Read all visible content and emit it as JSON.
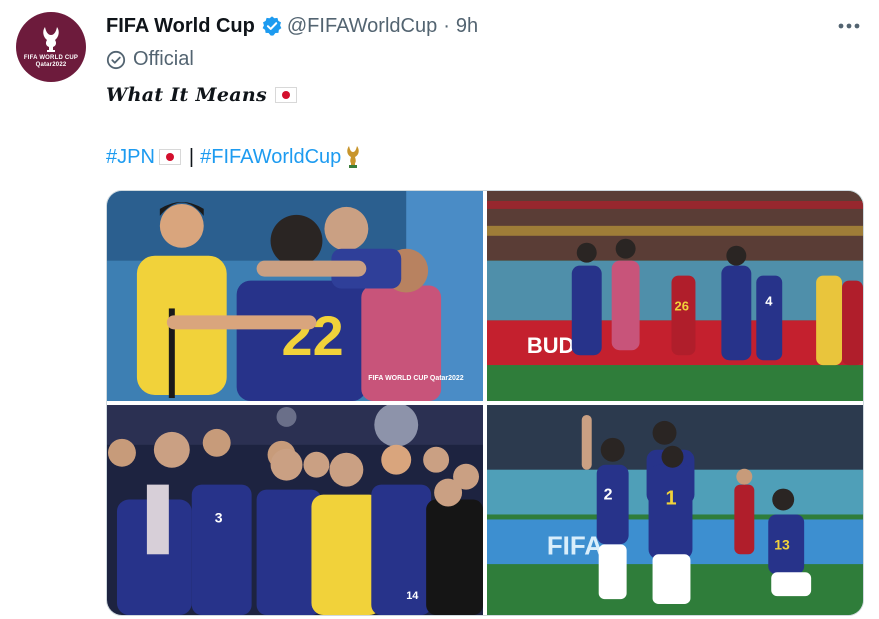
{
  "tweet": {
    "author_name": "FIFA World Cup",
    "handle": "@FIFAWorldCup",
    "separator": "·",
    "time": "9h",
    "label": "Official",
    "title": "What It Means",
    "hashtag_1": "#JPN",
    "divider": "|",
    "hashtag_2": "#FIFAWorldCup"
  },
  "avatar": {
    "line_1": "FIFA WORLD CUP",
    "line_2": "Qatar2022"
  },
  "photo_1": {
    "shirt_number": "22",
    "wordmark": "FIFA WORLD CUP Qatar2022"
  },
  "photo_2": {
    "ad_text": "BUD",
    "shirt_number_a": "26",
    "shirt_number_b": "4"
  },
  "photo_3": {
    "shirt_number": "3",
    "back_number": "14"
  },
  "photo_4": {
    "ad_text": "FIFA",
    "shirt_number_a": "1",
    "shirt_number_b": "13",
    "shirt_number_c": "2"
  },
  "colors": {
    "accent": "#1d9bf0",
    "verified": "#1d9bf0",
    "avatar_bg": "#6d1b3c",
    "japan_blue": "#27338a",
    "spain_red": "#b01e2b",
    "keeper_yellow": "#f1d23a",
    "pitch_green": "#2f7d3a"
  },
  "icons": {
    "verified": "verified-badge-icon",
    "official": "official-badge-icon",
    "more": "more-icon",
    "trophy": "trophy-icon",
    "japan_flag": "japan-flag-icon"
  }
}
